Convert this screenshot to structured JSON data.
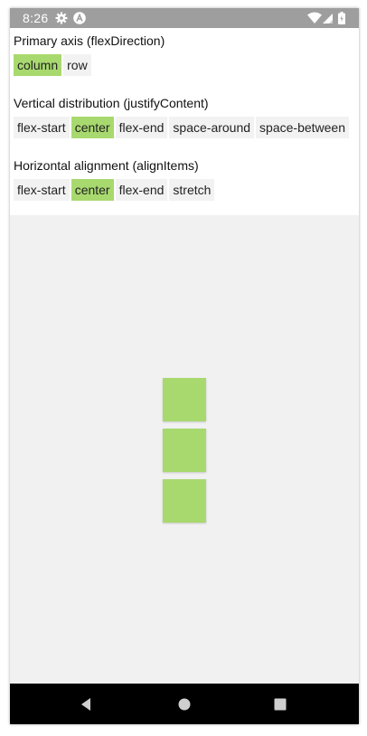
{
  "status_bar": {
    "time": "8:26",
    "icons": [
      "gear-icon",
      "app-a-icon",
      "wifi-icon",
      "signal-icon",
      "battery-icon"
    ]
  },
  "sections": [
    {
      "title": "Primary axis (flexDirection)",
      "options": [
        "column",
        "row"
      ],
      "selected": "column"
    },
    {
      "title": "Vertical distribution (justifyContent)",
      "options": [
        "flex-start",
        "center",
        "flex-end",
        "space-around",
        "space-between"
      ],
      "selected": "center"
    },
    {
      "title": "Horizontal alignment (alignItems)",
      "options": [
        "flex-start",
        "center",
        "flex-end",
        "stretch"
      ],
      "selected": "center"
    }
  ],
  "playground": {
    "box_count": 3
  },
  "nav_bar": {
    "buttons": [
      "back-icon",
      "home-icon",
      "recents-icon"
    ]
  },
  "colors": {
    "accent": "#a8d96e",
    "option_bg": "#f2f2f2",
    "status_bar": "#9e9e9e",
    "playground_bg": "#f1f1f1",
    "nav_bar": "#000000"
  }
}
